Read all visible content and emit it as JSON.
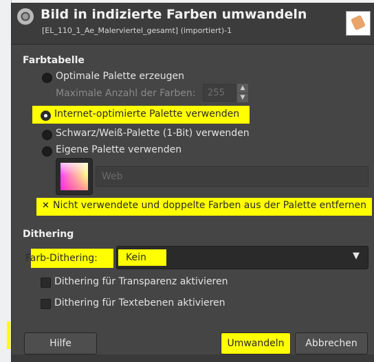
{
  "header": {
    "title": "Bild in indizierte Farben umwandeln",
    "subtitle": "[EL_110_1_Ae_Malerviertel_gesamt] (importiert)-1"
  },
  "palette_section": {
    "title": "Farbtabelle",
    "optimal_label": "Optimale Palette erzeugen",
    "max_colors_label": "Maximale Anzahl der Farben:",
    "max_colors_value": "255",
    "web_label": "Internet-optimierte Palette verwenden",
    "bw_label": "Schwarz/Weiß-Palette (1-Bit) verwenden",
    "custom_label": "Eigene Palette verwenden",
    "custom_palette_name": "Web",
    "remove_unused_label": "Nicht verwendete und doppelte Farben aus der Palette entfernen",
    "selected_option": "web",
    "remove_unused_checked": true
  },
  "dithering_section": {
    "title": "Dithering",
    "color_dithering_label": "Farb-Dithering:",
    "color_dithering_value": "Kein",
    "transparency_label": "Dithering für Transparenz aktivieren",
    "text_layers_label": "Dithering für Textebenen aktivieren",
    "transparency_checked": false,
    "text_layers_checked": false
  },
  "buttons": {
    "help": "Hilfe",
    "convert": "Umwandeln",
    "cancel": "Abbrechen"
  },
  "colors": {
    "highlight": "#ffff00",
    "dialog_bg": "#454545"
  },
  "icons": {
    "header": "gimp-indexed-icon",
    "preview": "image-preview-thumbnail",
    "combo": "chevron-down-icon",
    "spin_up": "arrow-up-icon",
    "spin_down": "arrow-down-icon"
  }
}
